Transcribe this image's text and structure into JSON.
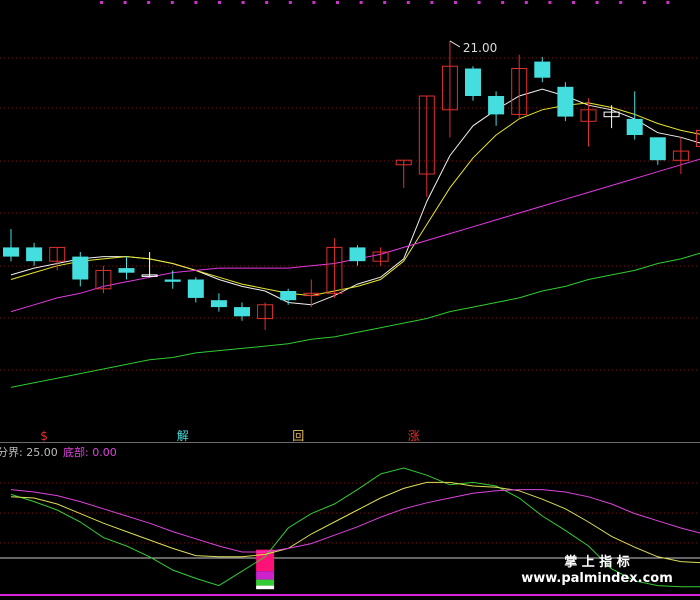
{
  "chart_data": [
    {
      "type": "candlestick",
      "panel": "price",
      "ylim": [
        5,
        22
      ],
      "max_label": "21.00",
      "candles": [
        {
          "o": 12.0,
          "h": 12.8,
          "l": 11.4,
          "c": 11.6,
          "dir": "down"
        },
        {
          "o": 12.0,
          "h": 12.2,
          "l": 11.2,
          "c": 11.4,
          "dir": "down"
        },
        {
          "o": 11.4,
          "h": 12.0,
          "l": 11.0,
          "c": 12.0,
          "dir": "up"
        },
        {
          "o": 11.6,
          "h": 11.8,
          "l": 10.3,
          "c": 10.6,
          "dir": "down"
        },
        {
          "o": 10.2,
          "h": 11.2,
          "l": 10.0,
          "c": 11.0,
          "dir": "up"
        },
        {
          "o": 11.1,
          "h": 11.6,
          "l": 10.6,
          "c": 10.9,
          "dir": "down"
        },
        {
          "o": 10.8,
          "h": 11.8,
          "l": 10.7,
          "c": 10.8,
          "dir": "flat"
        },
        {
          "o": 10.6,
          "h": 11.0,
          "l": 10.2,
          "c": 10.5,
          "dir": "down"
        },
        {
          "o": 10.6,
          "h": 10.7,
          "l": 9.6,
          "c": 9.8,
          "dir": "down"
        },
        {
          "o": 9.7,
          "h": 10.0,
          "l": 9.2,
          "c": 9.4,
          "dir": "down"
        },
        {
          "o": 9.4,
          "h": 9.6,
          "l": 8.8,
          "c": 9.0,
          "dir": "down"
        },
        {
          "o": 8.9,
          "h": 9.6,
          "l": 8.4,
          "c": 9.5,
          "dir": "up"
        },
        {
          "o": 10.1,
          "h": 10.2,
          "l": 9.5,
          "c": 9.7,
          "dir": "down"
        },
        {
          "o": 9.9,
          "h": 10.6,
          "l": 9.4,
          "c": 10.0,
          "dir": "up"
        },
        {
          "o": 10.0,
          "h": 12.4,
          "l": 9.8,
          "c": 12.0,
          "dir": "up"
        },
        {
          "o": 12.0,
          "h": 12.1,
          "l": 11.2,
          "c": 11.4,
          "dir": "down"
        },
        {
          "o": 11.4,
          "h": 12.0,
          "l": 11.2,
          "c": 11.8,
          "dir": "up"
        },
        {
          "o": 15.6,
          "h": 15.8,
          "l": 14.6,
          "c": 15.8,
          "dir": "up"
        },
        {
          "o": 15.2,
          "h": 18.6,
          "l": 14.2,
          "c": 18.6,
          "dir": "up"
        },
        {
          "o": 18.0,
          "h": 21.0,
          "l": 16.8,
          "c": 19.9,
          "dir": "up"
        },
        {
          "o": 19.8,
          "h": 19.9,
          "l": 18.4,
          "c": 18.6,
          "dir": "down"
        },
        {
          "o": 18.6,
          "h": 18.8,
          "l": 17.3,
          "c": 17.8,
          "dir": "down"
        },
        {
          "o": 17.8,
          "h": 20.4,
          "l": 17.6,
          "c": 19.8,
          "dir": "up"
        },
        {
          "o": 20.1,
          "h": 20.3,
          "l": 19.2,
          "c": 19.4,
          "dir": "down"
        },
        {
          "o": 19.0,
          "h": 19.2,
          "l": 17.5,
          "c": 17.7,
          "dir": "down"
        },
        {
          "o": 17.5,
          "h": 18.5,
          "l": 16.4,
          "c": 18.0,
          "dir": "up"
        },
        {
          "o": 17.9,
          "h": 18.2,
          "l": 17.2,
          "c": 17.7,
          "dir": "flat"
        },
        {
          "o": 17.6,
          "h": 18.8,
          "l": 16.7,
          "c": 16.9,
          "dir": "down"
        },
        {
          "o": 16.8,
          "h": 16.8,
          "l": 15.6,
          "c": 15.8,
          "dir": "down"
        },
        {
          "o": 15.8,
          "h": 16.8,
          "l": 15.2,
          "c": 16.2,
          "dir": "up"
        },
        {
          "o": 16.4,
          "h": 17.6,
          "l": 16.0,
          "c": 17.1,
          "dir": "up"
        }
      ],
      "series": [
        {
          "kind": "ma-white",
          "values": [
            10.8,
            11.1,
            11.3,
            11.5,
            11.6,
            11.6,
            11.5,
            11.3,
            11.0,
            10.6,
            10.3,
            10.1,
            9.6,
            9.5,
            9.9,
            10.4,
            10.7,
            11.5,
            14.0,
            16.0,
            17.3,
            18.0,
            18.6,
            18.9,
            18.6,
            18.2,
            18.0,
            17.6,
            17.0,
            16.8,
            16.5
          ]
        },
        {
          "kind": "ma-yellow",
          "values": [
            10.6,
            10.9,
            11.2,
            11.4,
            11.5,
            11.6,
            11.5,
            11.3,
            11.0,
            10.7,
            10.4,
            10.2,
            10.0,
            9.9,
            10.1,
            10.3,
            10.6,
            11.4,
            13.0,
            14.6,
            15.9,
            16.9,
            17.6,
            18.0,
            18.2,
            18.3,
            18.1,
            17.8,
            17.4,
            17.1,
            16.9
          ]
        },
        {
          "kind": "ma-magenta",
          "values": [
            9.2,
            9.5,
            9.8,
            10.0,
            10.3,
            10.5,
            10.7,
            10.9,
            11.0,
            11.1,
            11.1,
            11.1,
            11.1,
            11.2,
            11.3,
            11.5,
            11.7,
            12.0,
            12.3,
            12.6,
            12.9,
            13.2,
            13.5,
            13.8,
            14.1,
            14.4,
            14.7,
            15.0,
            15.3,
            15.6,
            15.9
          ]
        },
        {
          "kind": "ma-green",
          "values": [
            5.9,
            6.1,
            6.3,
            6.5,
            6.7,
            6.9,
            7.1,
            7.2,
            7.4,
            7.5,
            7.6,
            7.7,
            7.8,
            8.0,
            8.1,
            8.3,
            8.5,
            8.7,
            8.9,
            9.2,
            9.4,
            9.6,
            9.8,
            10.1,
            10.3,
            10.6,
            10.8,
            11.0,
            11.3,
            11.5,
            11.8
          ]
        }
      ],
      "signals": [
        {
          "index": 1,
          "text": "$",
          "color": "#e03030"
        },
        {
          "index": 7,
          "text": "解",
          "color": "#45dede"
        },
        {
          "index": 12,
          "text": "回",
          "color": "#e8c060"
        },
        {
          "index": 17,
          "text": "涨",
          "color": "#e03030"
        }
      ]
    },
    {
      "type": "line",
      "panel": "indicator",
      "ylim": [
        0,
        100
      ],
      "x": [
        0,
        1,
        2,
        3,
        4,
        5,
        6,
        7,
        8,
        9,
        10,
        11,
        12,
        13,
        14,
        15,
        16,
        17,
        18,
        19,
        20,
        21,
        22,
        23,
        24,
        25,
        26,
        27,
        28,
        29,
        30
      ],
      "reference_levels": [
        25
      ],
      "header": [
        {
          "label": "分界:",
          "value": "25.00",
          "color": "#bbbbbb"
        },
        {
          "label": "底部:",
          "value": "0.00",
          "color": "#dd44dd"
        }
      ],
      "series": [
        {
          "kind": "fast",
          "color": "#33cc33",
          "values": [
            78,
            72,
            65,
            55,
            42,
            35,
            26,
            15,
            8,
            2,
            14,
            26,
            50,
            62,
            70,
            82,
            95,
            100,
            94,
            86,
            88,
            85,
            75,
            60,
            48,
            35,
            16,
            6,
            2,
            1,
            1
          ]
        },
        {
          "kind": "medium",
          "color": "#dddd55",
          "values": [
            76,
            75,
            70,
            62,
            54,
            47,
            40,
            33,
            27,
            26,
            26,
            28,
            33,
            45,
            55,
            65,
            75,
            83,
            88,
            88,
            85,
            84,
            81,
            74,
            66,
            55,
            43,
            34,
            26,
            22,
            21
          ]
        },
        {
          "kind": "slow",
          "color": "#dd44dd",
          "values": [
            82,
            80,
            77,
            72,
            66,
            60,
            54,
            47,
            41,
            35,
            30,
            30,
            33,
            37,
            44,
            51,
            59,
            66,
            71,
            75,
            79,
            81,
            82,
            82,
            80,
            76,
            70,
            62,
            56,
            50,
            45
          ]
        }
      ],
      "bar_stack": {
        "index": 11,
        "segments": [
          {
            "from": 14,
            "to": 32,
            "color": "#ff1177"
          },
          {
            "from": 7,
            "to": 14,
            "color": "#cc22cc"
          },
          {
            "from": 2,
            "to": 7,
            "color": "#33cc33"
          },
          {
            "from": -1,
            "to": 2,
            "color": "#ffffff"
          }
        ]
      }
    }
  ],
  "watermark": {
    "line1": "掌 上 指 标",
    "line2": "www.palmindex.com"
  },
  "colors": {
    "background": "#000000",
    "up": "#e03030",
    "down": "#45dede",
    "grid": "#7a0f0f",
    "top_ticks": "#cc33cc",
    "divider": "#6a6a6a"
  }
}
